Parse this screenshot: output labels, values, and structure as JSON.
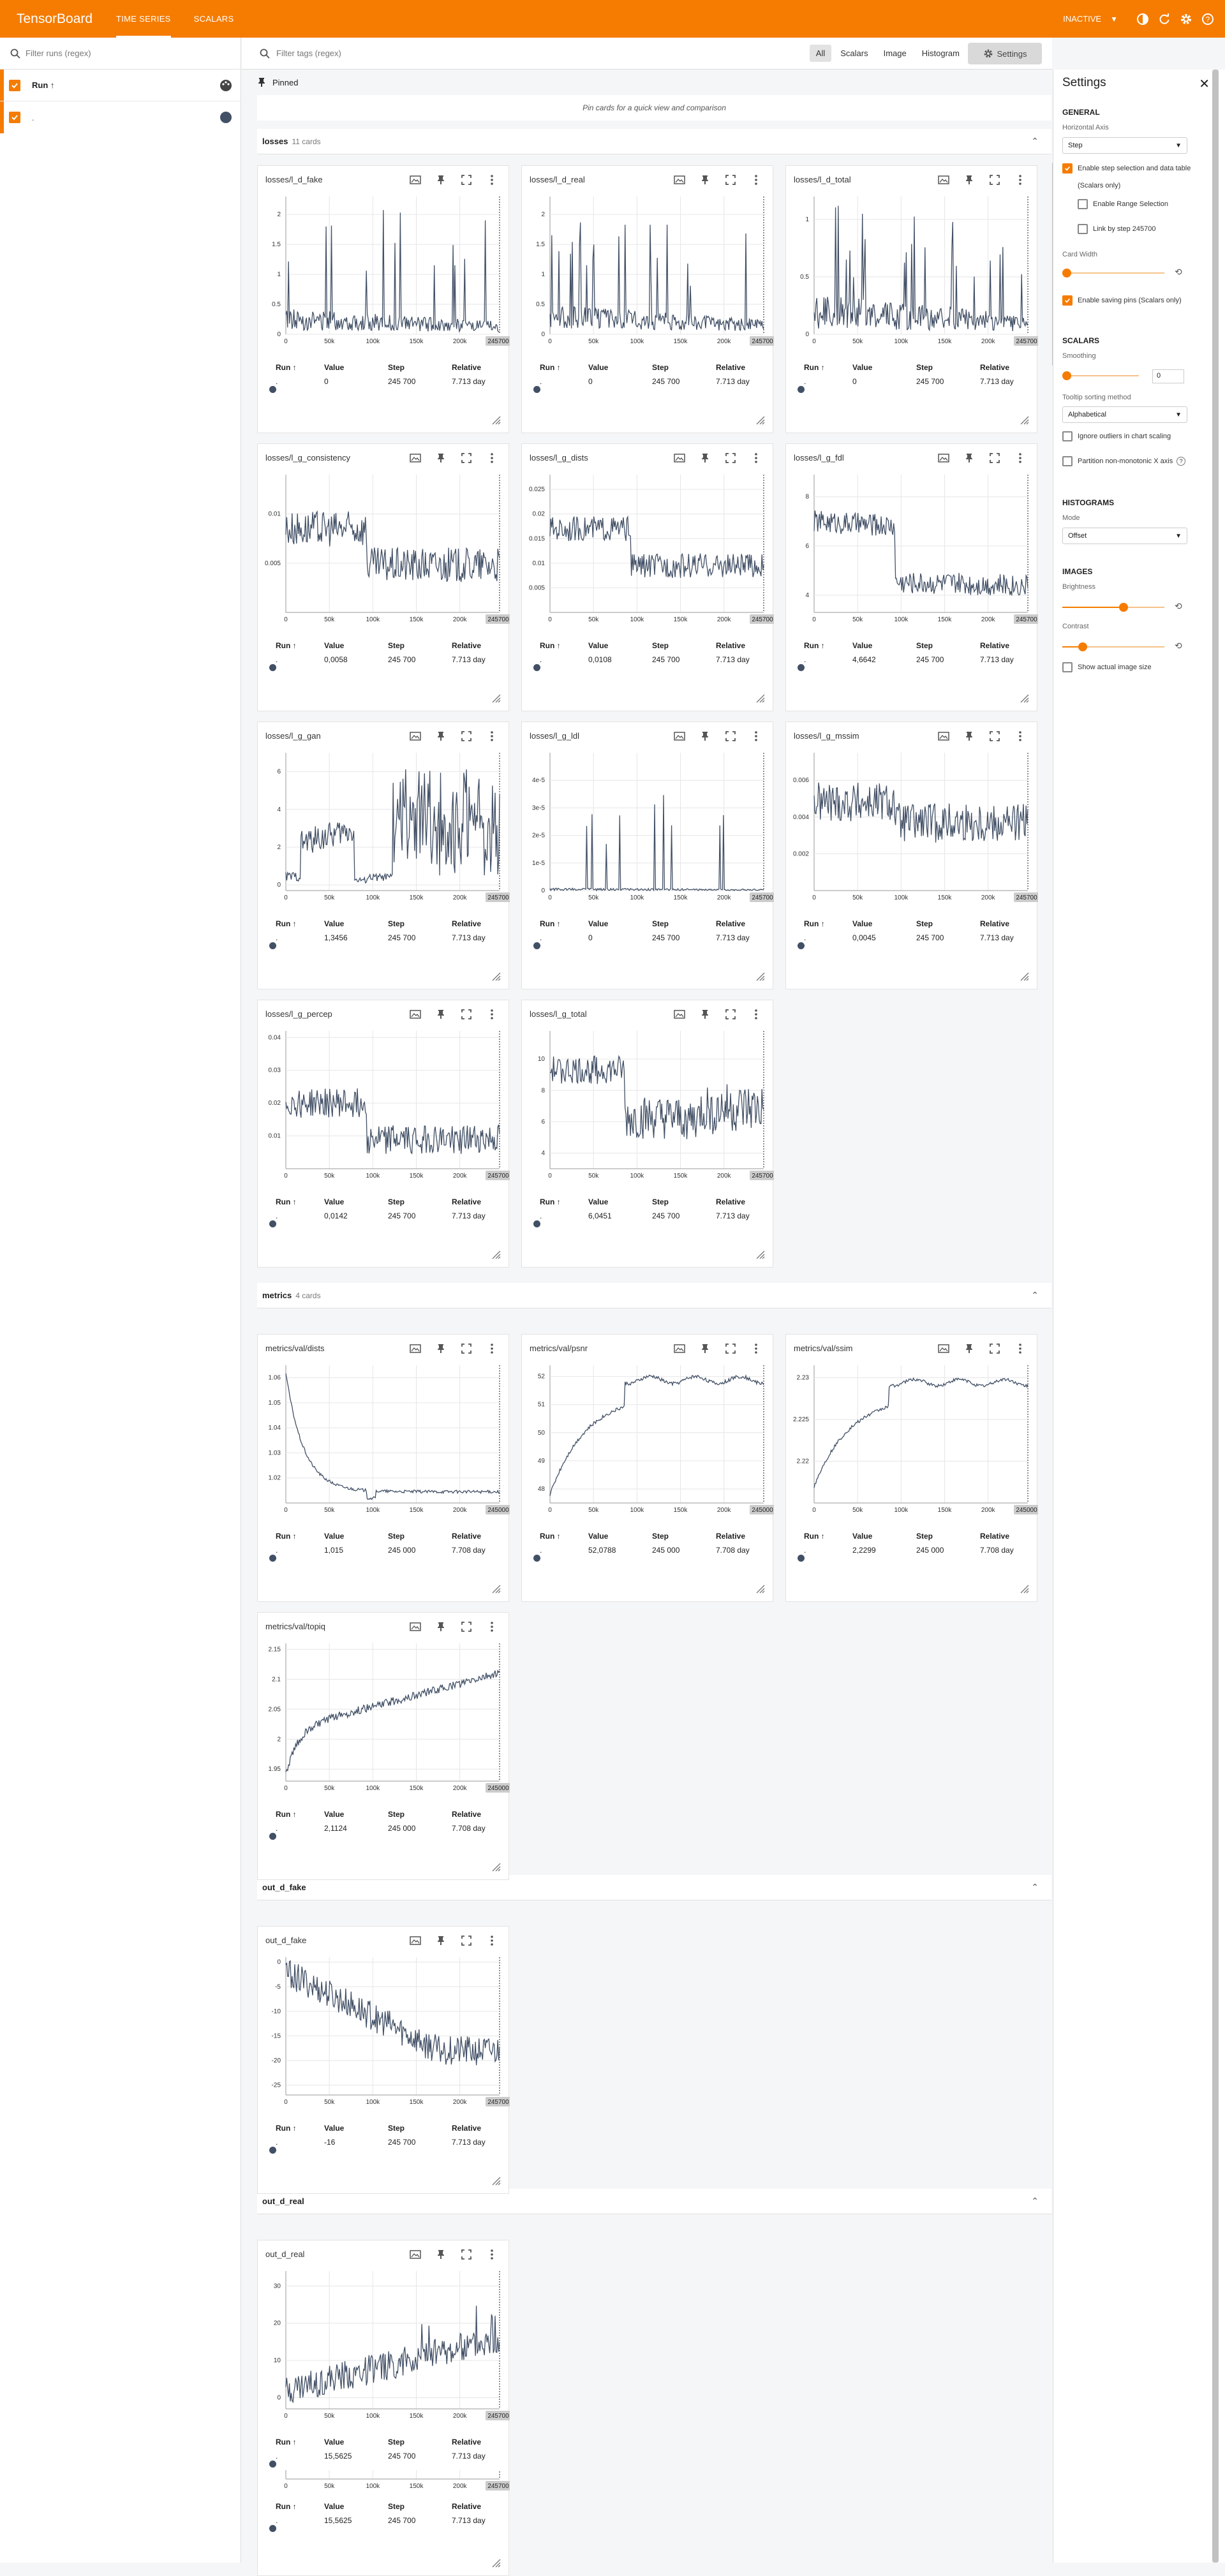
{
  "app": {
    "title": "TensorBoard",
    "tabs": [
      "TIME SERIES",
      "SCALARS"
    ],
    "status": "INACTIVE"
  },
  "sidebar": {
    "filter_placeholder": "Filter runs (regex)",
    "run_header": "Run ↑",
    "run_label": "."
  },
  "toolbar": {
    "tag_filter_placeholder": "Filter tags (regex)",
    "types": [
      "All",
      "Scalars",
      "Image",
      "Histogram"
    ],
    "settings_label": "Settings"
  },
  "pinned": {
    "title": "Pinned",
    "hint": "Pin cards for a quick view and comparison"
  },
  "table_headers": {
    "run": "Run ↑",
    "value": "Value",
    "step": "Step",
    "relative": "Relative"
  },
  "sections": [
    {
      "name": "losses",
      "count": "11 cards"
    },
    {
      "name": "metrics",
      "count": "4 cards"
    },
    {
      "name": "out_d_fake",
      "count": ""
    },
    {
      "name": "out_d_real",
      "count": ""
    }
  ],
  "cards": [
    {
      "title": "losses/l_d_fake",
      "run": ".",
      "value": "0",
      "step": "245 700",
      "relative": "7.713 day",
      "yticks": [
        "0",
        "0.5",
        "1",
        "1.5",
        "2"
      ],
      "xticks": [
        "0",
        "50k",
        "100k",
        "150k",
        "200k"
      ],
      "last_step": "245700",
      "shape": "spiky",
      "ylim": [
        0,
        2.3
      ],
      "base": 0.25,
      "amp": 0.18,
      "spike": 1.8
    },
    {
      "title": "losses/l_d_real",
      "run": ".",
      "value": "0",
      "step": "245 700",
      "relative": "7.713 day",
      "yticks": [
        "0",
        "0.5",
        "1",
        "1.5",
        "2"
      ],
      "xticks": [
        "0",
        "50k",
        "100k",
        "150k",
        "200k"
      ],
      "last_step": "245700",
      "shape": "spiky",
      "ylim": [
        0,
        2.3
      ],
      "base": 0.3,
      "amp": 0.2,
      "spike": 1.7
    },
    {
      "title": "losses/l_d_total",
      "run": ".",
      "value": "0",
      "step": "245 700",
      "relative": "7.713 day",
      "yticks": [
        "0",
        "0.5",
        "1"
      ],
      "xticks": [
        "0",
        "50k",
        "100k",
        "150k",
        "200k"
      ],
      "last_step": "245700",
      "shape": "spiky",
      "ylim": [
        0,
        1.2
      ],
      "base": 0.2,
      "amp": 0.15,
      "spike": 0.95
    },
    {
      "title": "losses/l_g_consistency",
      "run": ".",
      "value": "0,0058",
      "step": "245 700",
      "relative": "7.713 day",
      "yticks": [
        "0.005",
        "0.01"
      ],
      "xticks": [
        "0",
        "50k",
        "100k",
        "150k",
        "200k"
      ],
      "last_step": "245700",
      "shape": "drop",
      "ylim": [
        0,
        0.014
      ],
      "y0": 0.0085,
      "y1": 0.0048,
      "amp": 0.0018
    },
    {
      "title": "losses/l_g_dists",
      "run": ".",
      "value": "0,0108",
      "step": "245 700",
      "relative": "7.713 day",
      "yticks": [
        "0.005",
        "0.01",
        "0.015",
        "0.02",
        "0.025"
      ],
      "xticks": [
        "0",
        "50k",
        "100k",
        "150k",
        "200k"
      ],
      "last_step": "245700",
      "shape": "drop",
      "ylim": [
        0,
        0.028
      ],
      "y0": 0.017,
      "y1": 0.0095,
      "amp": 0.0025
    },
    {
      "title": "losses/l_g_fdl",
      "run": ".",
      "value": "4,6642",
      "step": "245 700",
      "relative": "7.713 day",
      "yticks": [
        "4",
        "6",
        "8"
      ],
      "xticks": [
        "0",
        "50k",
        "100k",
        "150k",
        "200k"
      ],
      "last_step": "245700",
      "shape": "step",
      "ylim": [
        3.3,
        8.9
      ],
      "y0": 7.0,
      "y1": 4.6,
      "amp": 0.45
    },
    {
      "title": "losses/l_g_gan",
      "run": ".",
      "value": "1,3456",
      "step": "245 700",
      "relative": "7.713 day",
      "yticks": [
        "0",
        "2",
        "4",
        "6"
      ],
      "xticks": [
        "0",
        "50k",
        "100k",
        "150k",
        "200k"
      ],
      "last_step": "245700",
      "shape": "gan",
      "ylim": [
        -0.3,
        7
      ]
    },
    {
      "title": "losses/l_g_ldl",
      "run": ".",
      "value": "0",
      "step": "245 700",
      "relative": "7.713 day",
      "yticks": [
        "0",
        "1e-5",
        "2e-5",
        "3e-5",
        "4e-5"
      ],
      "xticks": [
        "0",
        "50k",
        "100k",
        "150k",
        "200k"
      ],
      "last_step": "245700",
      "shape": "spiky",
      "ylim": [
        0,
        5
      ],
      "base": 0.05,
      "amp": 0.05,
      "spike": 3.6
    },
    {
      "title": "losses/l_g_mssim",
      "run": ".",
      "value": "0,0045",
      "step": "245 700",
      "relative": "7.713 day",
      "yticks": [
        "0.002",
        "0.004",
        "0.006"
      ],
      "xticks": [
        "0",
        "50k",
        "100k",
        "150k",
        "200k"
      ],
      "last_step": "245700",
      "shape": "drop",
      "ylim": [
        0,
        0.0075
      ],
      "y0": 0.0048,
      "y1": 0.0037,
      "amp": 0.0011
    },
    {
      "title": "losses/l_g_percep",
      "run": ".",
      "value": "0,0142",
      "step": "245 700",
      "relative": "7.713 day",
      "yticks": [
        "0.01",
        "0.02",
        "0.03",
        "0.04"
      ],
      "xticks": [
        "0",
        "50k",
        "100k",
        "150k",
        "200k"
      ],
      "last_step": "245700",
      "shape": "drop",
      "ylim": [
        0,
        0.042
      ],
      "y0": 0.02,
      "y1": 0.009,
      "amp": 0.0045
    },
    {
      "title": "losses/l_g_total",
      "run": ".",
      "value": "6,0451",
      "step": "245 700",
      "relative": "7.713 day",
      "yticks": [
        "4",
        "6",
        "8",
        "10"
      ],
      "xticks": [
        "0",
        "50k",
        "100k",
        "150k",
        "200k"
      ],
      "last_step": "245700",
      "shape": "total",
      "ylim": [
        3,
        11.8
      ]
    },
    {
      "title": "metrics/val/dists",
      "run": ".",
      "value": "1,015",
      "step": "245 000",
      "relative": "7.708 day",
      "yticks": [
        "1.02",
        "1.03",
        "1.04",
        "1.05",
        "1.06"
      ],
      "xticks": [
        "0",
        "50k",
        "100k",
        "150k",
        "200k"
      ],
      "last_step": "245000",
      "shape": "decay",
      "ylim": [
        1.01,
        1.065
      ],
      "y0": 1.062,
      "y1": 1.0145
    },
    {
      "title": "metrics/val/psnr",
      "run": ".",
      "value": "52,0788",
      "step": "245 000",
      "relative": "7.708 day",
      "yticks": [
        "48",
        "49",
        "50",
        "51",
        "52"
      ],
      "xticks": [
        "0",
        "50k",
        "100k",
        "150k",
        "200k"
      ],
      "last_step": "245000",
      "shape": "rise",
      "ylim": [
        47.5,
        52.4
      ],
      "y0": 47.8,
      "y1": 52.0
    },
    {
      "title": "metrics/val/ssim",
      "run": ".",
      "value": "2,2299",
      "step": "245 000",
      "relative": "7.708 day",
      "yticks": [
        "2.22",
        "2.225",
        "2.23"
      ],
      "xticks": [
        "0",
        "50k",
        "100k",
        "150k",
        "200k"
      ],
      "last_step": "245000",
      "shape": "rise",
      "ylim": [
        2.215,
        2.2315
      ],
      "y0": 2.217,
      "y1": 2.2298
    },
    {
      "title": "metrics/val/topiq",
      "run": ".",
      "value": "2,1124",
      "step": "245 000",
      "relative": "7.708 day",
      "yticks": [
        "1.95",
        "2",
        "2.05",
        "2.1",
        "2.15"
      ],
      "xticks": [
        "0",
        "50k",
        "100k",
        "150k",
        "200k"
      ],
      "last_step": "245000",
      "shape": "rise2",
      "ylim": [
        1.93,
        2.16
      ],
      "y0": 1.94,
      "y1": 2.11
    },
    {
      "title": "out_d_fake",
      "run": ".",
      "value": "-16",
      "step": "245 700",
      "relative": "7.713 day",
      "yticks": [
        "0",
        "-5",
        "-10",
        "-15",
        "-20",
        "-25"
      ],
      "xticks": [
        "0",
        "50k",
        "100k",
        "150k",
        "200k"
      ],
      "last_step": "245700",
      "shape": "fall",
      "ylim": [
        -27,
        1
      ],
      "y0": -2,
      "y1": -18,
      "amp": 3
    },
    {
      "title": "out_d_real",
      "run": ".",
      "value": "15,5625",
      "step": "245 700",
      "relative": "7.713 day",
      "yticks": [
        "0",
        "10",
        "20",
        "30"
      ],
      "xticks": [
        "0",
        "50k",
        "100k",
        "150k",
        "200k"
      ],
      "last_step": "245700",
      "shape": "climb",
      "ylim": [
        -3,
        34
      ],
      "y0": 2,
      "y1": 16,
      "amp": 4
    }
  ],
  "extra_row": {
    "run": ".",
    "value": "15,5625",
    "step": "245 700",
    "relative": "7.713 day",
    "xticks": [
      "0",
      "50k",
      "100k",
      "150k",
      "200k"
    ],
    "last_step": "245700"
  },
  "settings": {
    "title": "Settings",
    "general": "GENERAL",
    "horizontal_axis_label": "Horizontal Axis",
    "horizontal_axis_value": "Step",
    "enable_step_selection": "Enable step selection and data table",
    "scalars_only": "(Scalars only)",
    "enable_range_selection": "Enable Range Selection",
    "link_by_step": "Link by step 245700",
    "card_width": "Card Width",
    "enable_pins": "Enable saving pins (Scalars only)",
    "scalars": "SCALARS",
    "smoothing_label": "Smoothing",
    "smoothing_value": "0",
    "tooltip_sort_label": "Tooltip sorting method",
    "tooltip_sort_value": "Alphabetical",
    "ignore_outliers": "Ignore outliers in chart scaling",
    "partition_nonmono": "Partition non-monotonic X axis",
    "histograms": "HISTOGRAMS",
    "mode_label": "Mode",
    "mode_value": "Offset",
    "images": "IMAGES",
    "brightness_label": "Brightness",
    "contrast_label": "Contrast",
    "show_actual": "Show actual image size",
    "card_width_level": 0.0,
    "smoothing_level": 0.0,
    "brightness_level": 0.6,
    "contrast_level": 0.2
  },
  "colors": {
    "accent": "#f57c00",
    "series": "#425066"
  }
}
